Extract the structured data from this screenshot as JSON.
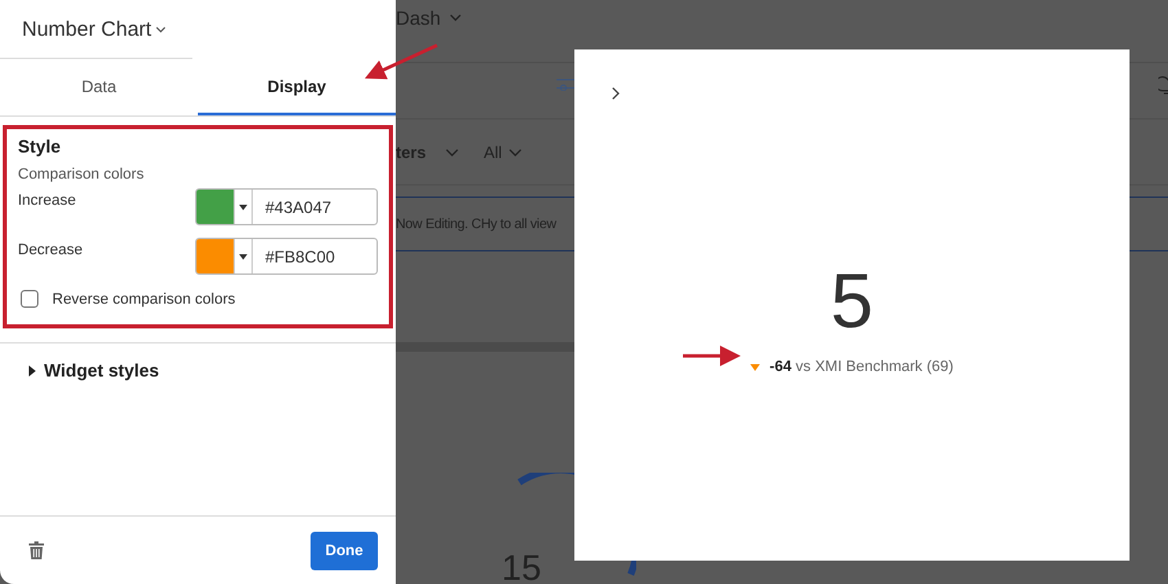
{
  "panel": {
    "title": "Number Chart",
    "tabs": [
      {
        "label": "Data",
        "selected": false
      },
      {
        "label": "Display",
        "selected": true
      }
    ],
    "style_section": {
      "heading": "Style",
      "subheading": "Comparison colors",
      "colors": [
        {
          "label": "Increase",
          "color": "#43a047",
          "value": "#43A047"
        },
        {
          "label": "Decrease",
          "color": "#fb8c00",
          "value": "#FB8C00"
        }
      ],
      "reverse": {
        "label": "Reverse comparison colors",
        "checked": false
      }
    },
    "widget_styles": {
      "label": "Widget styles",
      "expanded": false
    },
    "done_button": "Done"
  },
  "dashboard": {
    "title": "Dash",
    "filter_label": "ters",
    "filter_value": "All",
    "banner": "Now Editing. CHy to all view",
    "gauge_value": "15"
  },
  "widget": {
    "value": "5",
    "comparison": {
      "delta": "-64",
      "text": "vs XMI Benchmark (69)",
      "kind": "decrease"
    }
  }
}
